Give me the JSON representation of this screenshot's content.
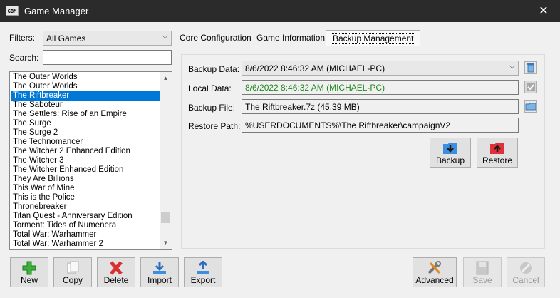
{
  "window": {
    "title": "Game Manager",
    "icon_text": "GBM",
    "close_glyph": "✕"
  },
  "filters": {
    "label": "Filters:",
    "selected": "All Games"
  },
  "search": {
    "label": "Search:",
    "value": ""
  },
  "games": [
    "The Outer Worlds",
    "The Outer Worlds",
    "The Riftbreaker",
    "The Saboteur",
    "The Settlers: Rise of an Empire",
    "The Surge",
    "The Surge 2",
    "The Technomancer",
    "The Witcher 2 Enhanced Edition",
    "The Witcher 3",
    "The Witcher Enhanced Edition",
    "They Are Billions",
    "This War of Mine",
    "This is the Police",
    "Thronebreaker",
    "Titan Quest - Anniversary Edition",
    "Torment: Tides of Numenera",
    "Total War: Warhammer",
    "Total War: Warhammer 2"
  ],
  "selected_game_index": 2,
  "tabs": [
    {
      "label": "Core Configuration"
    },
    {
      "label": "Game Information"
    },
    {
      "label": "Backup Management"
    }
  ],
  "backup": {
    "backup_data_label": "Backup Data:",
    "backup_data_value": "8/6/2022 8:46:32 AM (MICHAEL-PC)",
    "local_data_label": "Local Data:",
    "local_data_value": "8/6/2022 8:46:32 AM (MICHAEL-PC)",
    "backup_file_label": "Backup File:",
    "backup_file_value": "The Riftbreaker.7z (45.39 MB)",
    "restore_path_label": "Restore Path:",
    "restore_path_value": "%USERDOCUMENTS%\\The Riftbreaker\\campaignV2",
    "backup_button": "Backup",
    "restore_button": "Restore"
  },
  "toolbar": {
    "new": "New",
    "copy": "Copy",
    "delete": "Delete",
    "import": "Import",
    "export": "Export",
    "advanced": "Advanced",
    "save": "Save",
    "cancel": "Cancel"
  },
  "colors": {
    "selection": "#0078d7",
    "local_data_text": "#1f8a1f",
    "titlebar": "#2b2b2b"
  }
}
